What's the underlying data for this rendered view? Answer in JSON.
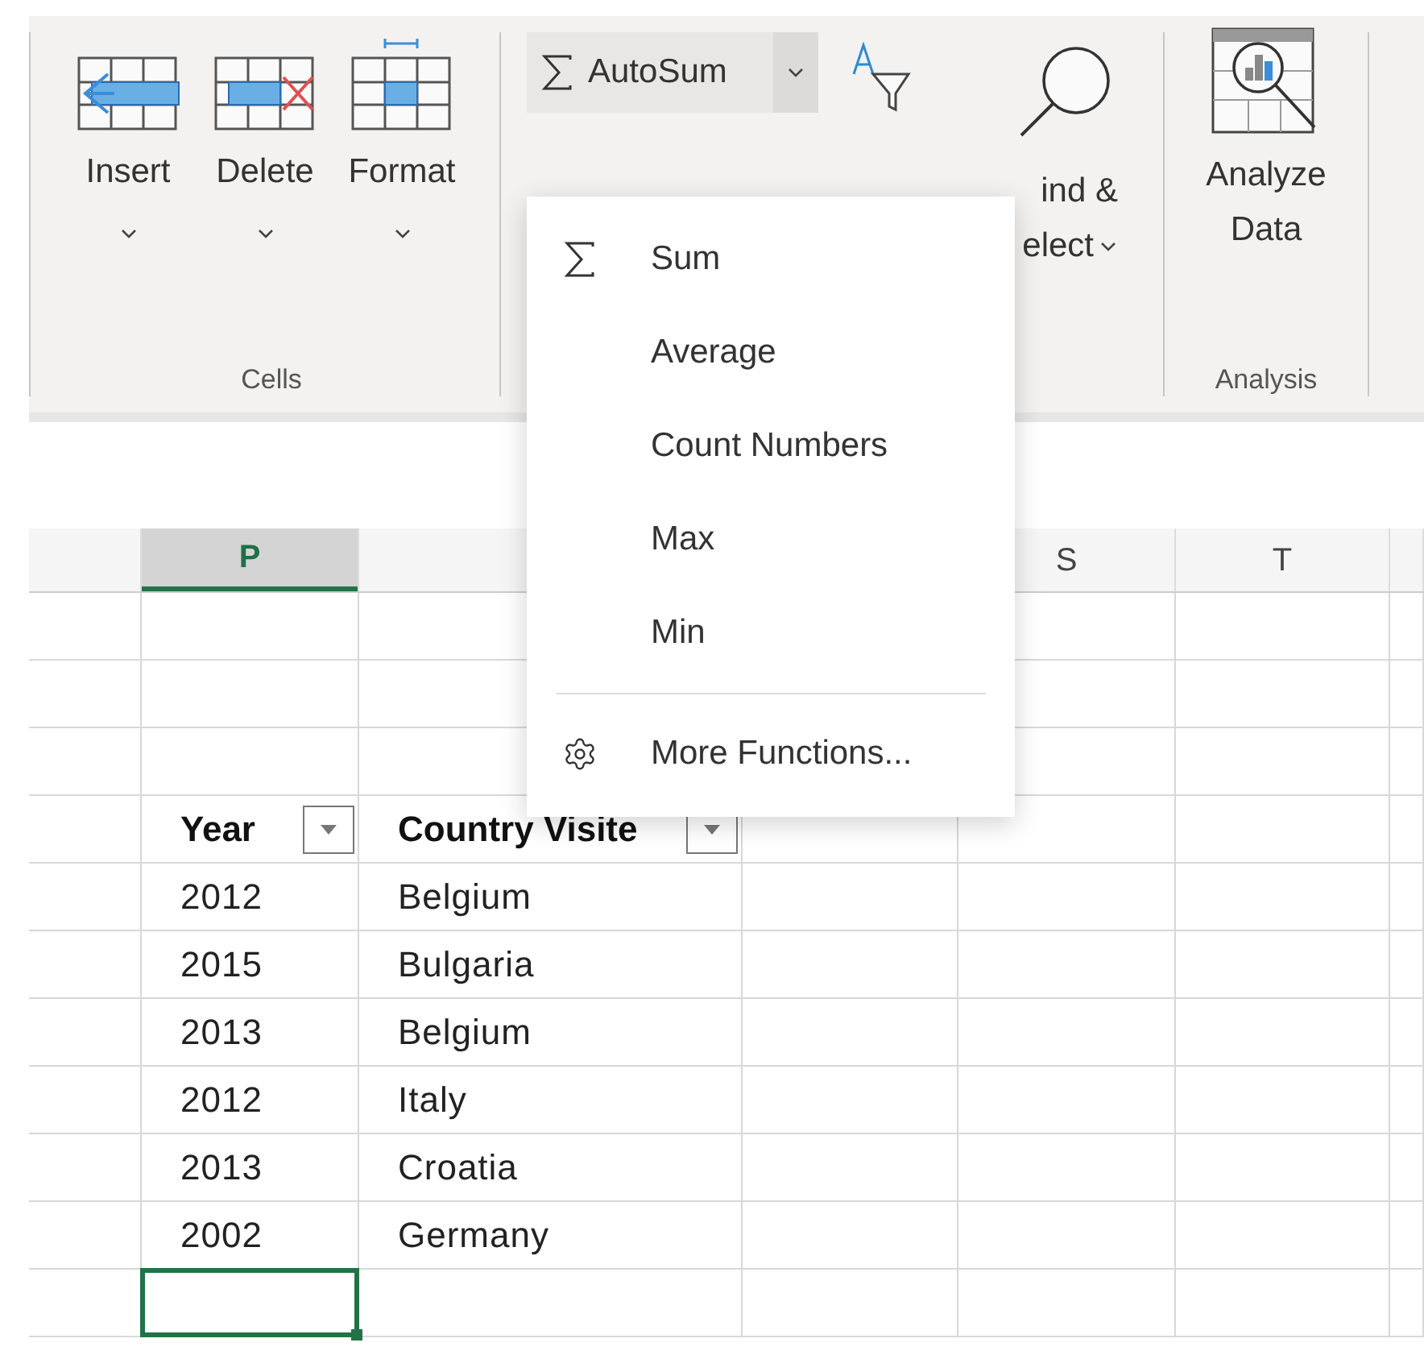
{
  "ribbon": {
    "cells_group": {
      "label": "Cells",
      "buttons": [
        {
          "kind": "insert",
          "label": "Insert"
        },
        {
          "kind": "delete",
          "label": "Delete"
        },
        {
          "kind": "format",
          "label": "Format"
        }
      ]
    },
    "editing_group": {
      "autosum": {
        "label": "AutoSum",
        "expanded": true
      },
      "find_select": {
        "line_1": "ind &",
        "line_2": "elect"
      }
    },
    "analysis_group": {
      "label": "Analysis",
      "button": {
        "line_1": "Analyze",
        "line_2": "Data"
      }
    }
  },
  "autosum_menu": {
    "groups": [
      [
        {
          "kind": "sigma",
          "label": "Sum"
        },
        {
          "kind": "plain",
          "label": "Average"
        },
        {
          "kind": "plain",
          "label": "Count Numbers"
        },
        {
          "kind": "plain",
          "label": "Max"
        },
        {
          "kind": "plain",
          "label": "Min"
        }
      ],
      [
        {
          "kind": "gear",
          "label": "More Functions..."
        }
      ]
    ]
  },
  "sheet": {
    "column_headers": [
      {
        "label": "P",
        "selected": true
      },
      {
        "label": "S",
        "selected": false
      },
      {
        "label": "T",
        "selected": false
      }
    ],
    "table": {
      "columns": [
        "Year",
        "Country Visite"
      ],
      "rows": [
        [
          "2012",
          "Belgium"
        ],
        [
          "2015",
          "Bulgaria"
        ],
        [
          "2013",
          "Belgium"
        ],
        [
          "2012",
          "Italy"
        ],
        [
          "2013",
          "Croatia"
        ],
        [
          "2002",
          "Germany"
        ]
      ]
    },
    "selected_cell_active": true
  }
}
